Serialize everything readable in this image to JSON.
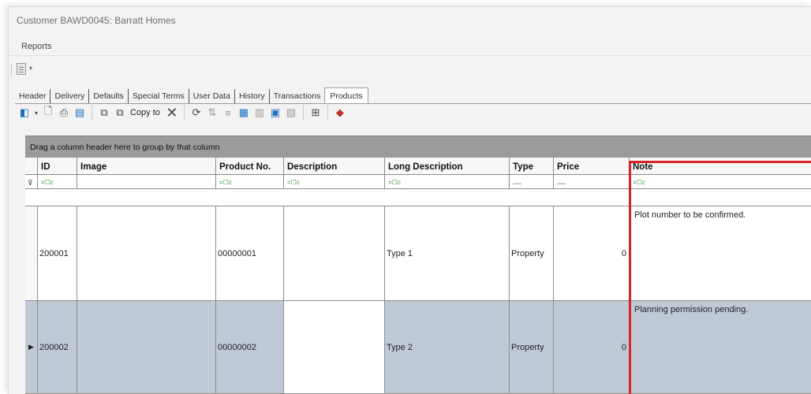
{
  "window": {
    "title": "Customer BAWD0045: Barratt Homes"
  },
  "menu": {
    "reports": "Reports"
  },
  "tabs": [
    "Header",
    "Delivery",
    "Defaults",
    "Special Terms",
    "User Data",
    "History",
    "Transactions",
    "Products"
  ],
  "active_tab": "Products",
  "toolbar": {
    "copy_to_label": "Copy to"
  },
  "grid": {
    "group_hint": "Drag a column header here to group by that column",
    "columns": [
      "ID",
      "Image",
      "Product No.",
      "Description",
      "Long Description",
      "Type",
      "Price",
      "Note"
    ],
    "filter_symbol": "=☐c",
    "rows": [
      {
        "id": "200001",
        "image": "",
        "product_no": "00000001",
        "description": "",
        "long_description": "Type 1",
        "type": "Property",
        "price": "0",
        "note": "Plot number to be confirmed."
      },
      {
        "id": "200002",
        "image": "",
        "product_no": "00000002",
        "description": "",
        "long_description": "Type 2",
        "type": "Property",
        "price": "0",
        "note": "Planning permission pending."
      }
    ]
  },
  "colors": {
    "selected_row": "#bfcad6",
    "group_bar": "#9b9b9b",
    "highlight": "#d8222c"
  }
}
